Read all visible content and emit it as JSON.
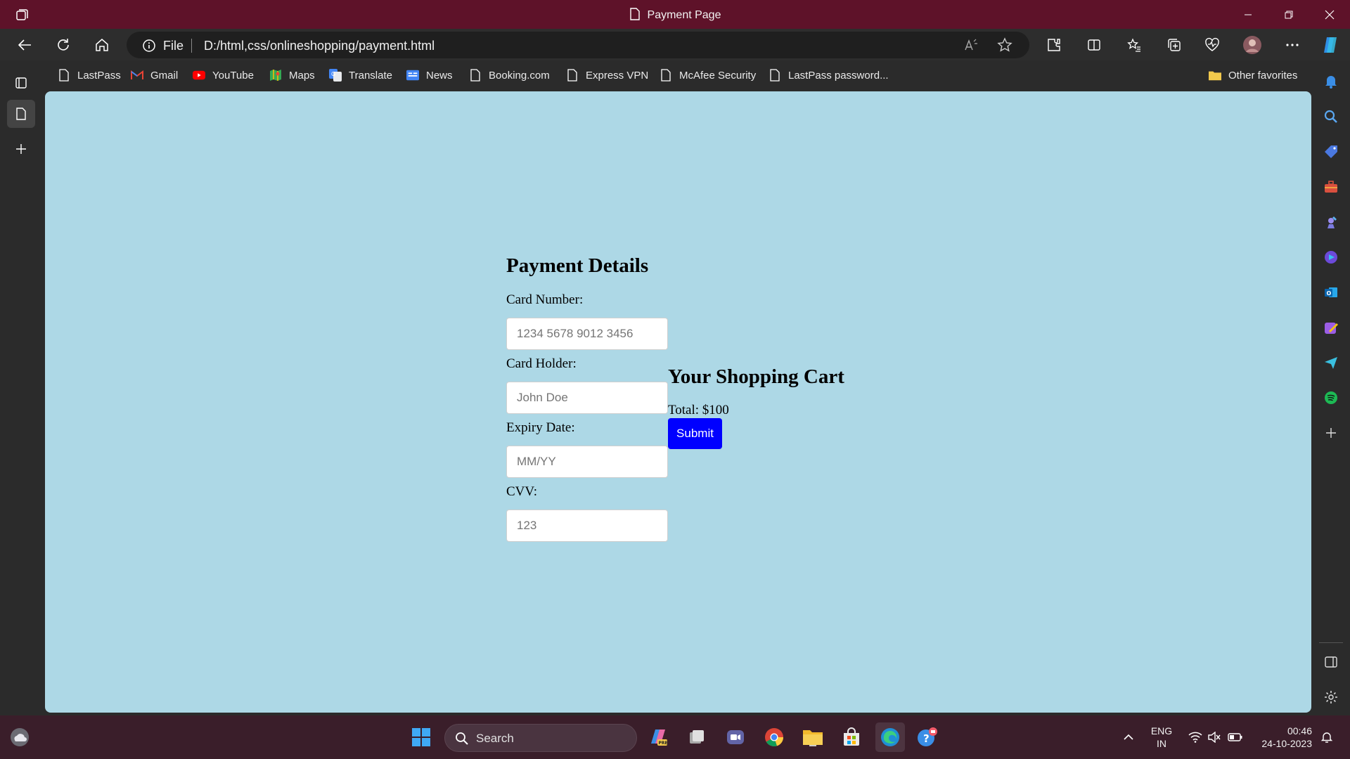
{
  "window": {
    "tab_title": "Payment Page"
  },
  "addressbar": {
    "scheme": "File",
    "url": "D:/html,css/onlineshopping/payment.html"
  },
  "favorites": {
    "items": [
      {
        "label": "LastPass",
        "icon": "page-icon"
      },
      {
        "label": "Gmail",
        "icon": "gmail-icon"
      },
      {
        "label": "YouTube",
        "icon": "youtube-icon"
      },
      {
        "label": "Maps",
        "icon": "maps-icon"
      },
      {
        "label": "Translate",
        "icon": "translate-icon"
      },
      {
        "label": "News",
        "icon": "news-icon"
      },
      {
        "label": "Booking.com",
        "icon": "page-icon"
      },
      {
        "label": "Express VPN",
        "icon": "page-icon"
      },
      {
        "label": "McAfee Security",
        "icon": "page-icon"
      },
      {
        "label": "LastPass password...",
        "icon": "page-icon"
      }
    ],
    "other": "Other favorites"
  },
  "page": {
    "payment_title": "Payment Details",
    "card_number_label": "Card Number:",
    "card_number_placeholder": "1234 5678 9012 3456",
    "card_holder_label": "Card Holder:",
    "card_holder_placeholder": "John Doe",
    "expiry_label": "Expiry Date:",
    "expiry_placeholder": "MM/YY",
    "cvv_label": "CVV:",
    "cvv_placeholder": "123",
    "cart_title": "Your Shopping Cart",
    "total": "Total: $100",
    "submit_label": "Submit",
    "submit_color": "#0000ff",
    "background_color": "#add8e6"
  },
  "taskbar": {
    "search_label": "Search",
    "lang_line1": "ENG",
    "lang_line2": "IN",
    "time": "00:46",
    "date": "24-10-2023"
  },
  "colors": {
    "titlebar": "#5e1229",
    "taskbar": "#3a1e2a"
  }
}
